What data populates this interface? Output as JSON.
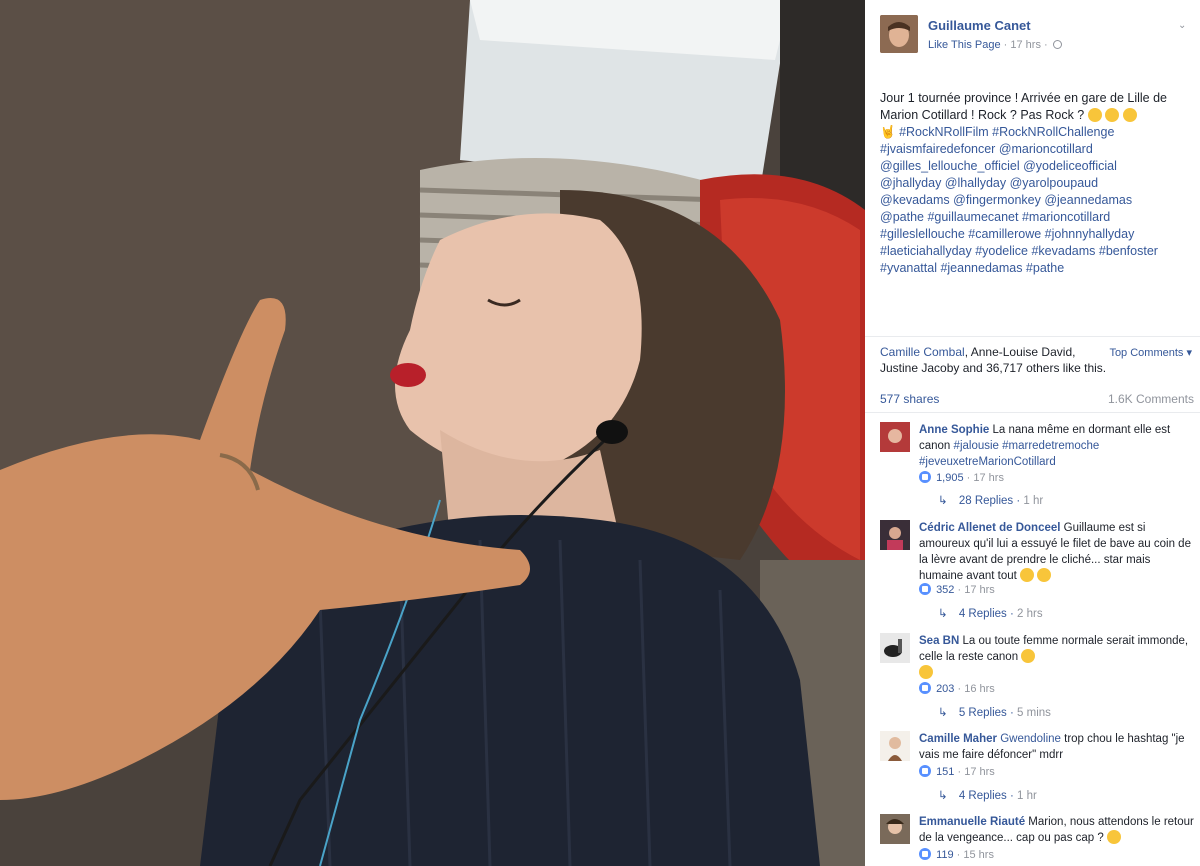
{
  "post": {
    "page_name": "Guillaume Canet",
    "like_page": "Like This Page",
    "time": "17 hrs",
    "text_plain": "Jour 1 tournée province ! Arrivée en gare de Lille de Marion Cotillard ! Rock ? Pas Rock ?",
    "hashtags_line1": "#RockNRollFilm #RockNRollChallenge",
    "hashtags_line2": "#jvaismfairedefoncer",
    "mentions_1": "@marioncotillard",
    "mentions_2": "@gilles_lellouche_officiel @yodeliceofficial",
    "mentions_3": "@jhallyday @lhallyday @yarolpoupaud",
    "mentions_4": "@kevadams @fingermonkey @jeannedamas",
    "mentions_5": "@pathe #guillaumecanet #marioncotillard",
    "mentions_6": "#gilleslellouche #camillerowe #johnnyhallyday",
    "mentions_7": "#laeticiahallyday #yodelice #kevadams #benfoster",
    "mentions_8": "#yvanattal #jeannedamas #pathe"
  },
  "likes": {
    "name1": "Camille Combal",
    "name2": "Anne-Louise David,",
    "rest": "Justine Jacoby and 36,717 others like this.",
    "top_comments": "Top Comments"
  },
  "stats": {
    "shares": "577 shares",
    "comments": "1.6K Comments"
  },
  "comments": [
    {
      "author": "Anne Sophie",
      "text": "La nana même en dormant elle est canon",
      "tags": "#jalousie #marredetremoche #jeveuxetreMarionCotillard",
      "likes": "1,905",
      "time": "17 hrs",
      "replies": "28 Replies",
      "reply_time": "1 hr"
    },
    {
      "author": "Cédric Allenet de Donceel",
      "text": "Guillaume est si amoureux qu'il lui a essuyé le filet de bave au coin de la lèvre avant de prendre le cliché... star mais humaine avant tout",
      "likes": "352",
      "time": "17 hrs",
      "replies": "4 Replies",
      "reply_time": "2 hrs"
    },
    {
      "author": "Sea BN",
      "text": "La ou toute femme normale serait immonde, celle la reste canon",
      "likes": "203",
      "time": "16 hrs",
      "replies": "5 Replies",
      "reply_time": "5 mins"
    },
    {
      "author": "Camille Maher",
      "mention": "Gwendoline",
      "text": "trop chou le hashtag \"je vais me faire défoncer\" mdrr",
      "likes": "151",
      "time": "17 hrs",
      "replies": "4 Replies",
      "reply_time": "1 hr"
    },
    {
      "author": "Emmanuelle Riauté",
      "text": "Marion, nous attendons le retour de la vengeance... cap ou pas cap ?",
      "likes": "119",
      "time": "15 hrs"
    }
  ],
  "colors": {
    "link": "#365899",
    "meta": "#90949c",
    "like_blue": "#5890ff"
  }
}
